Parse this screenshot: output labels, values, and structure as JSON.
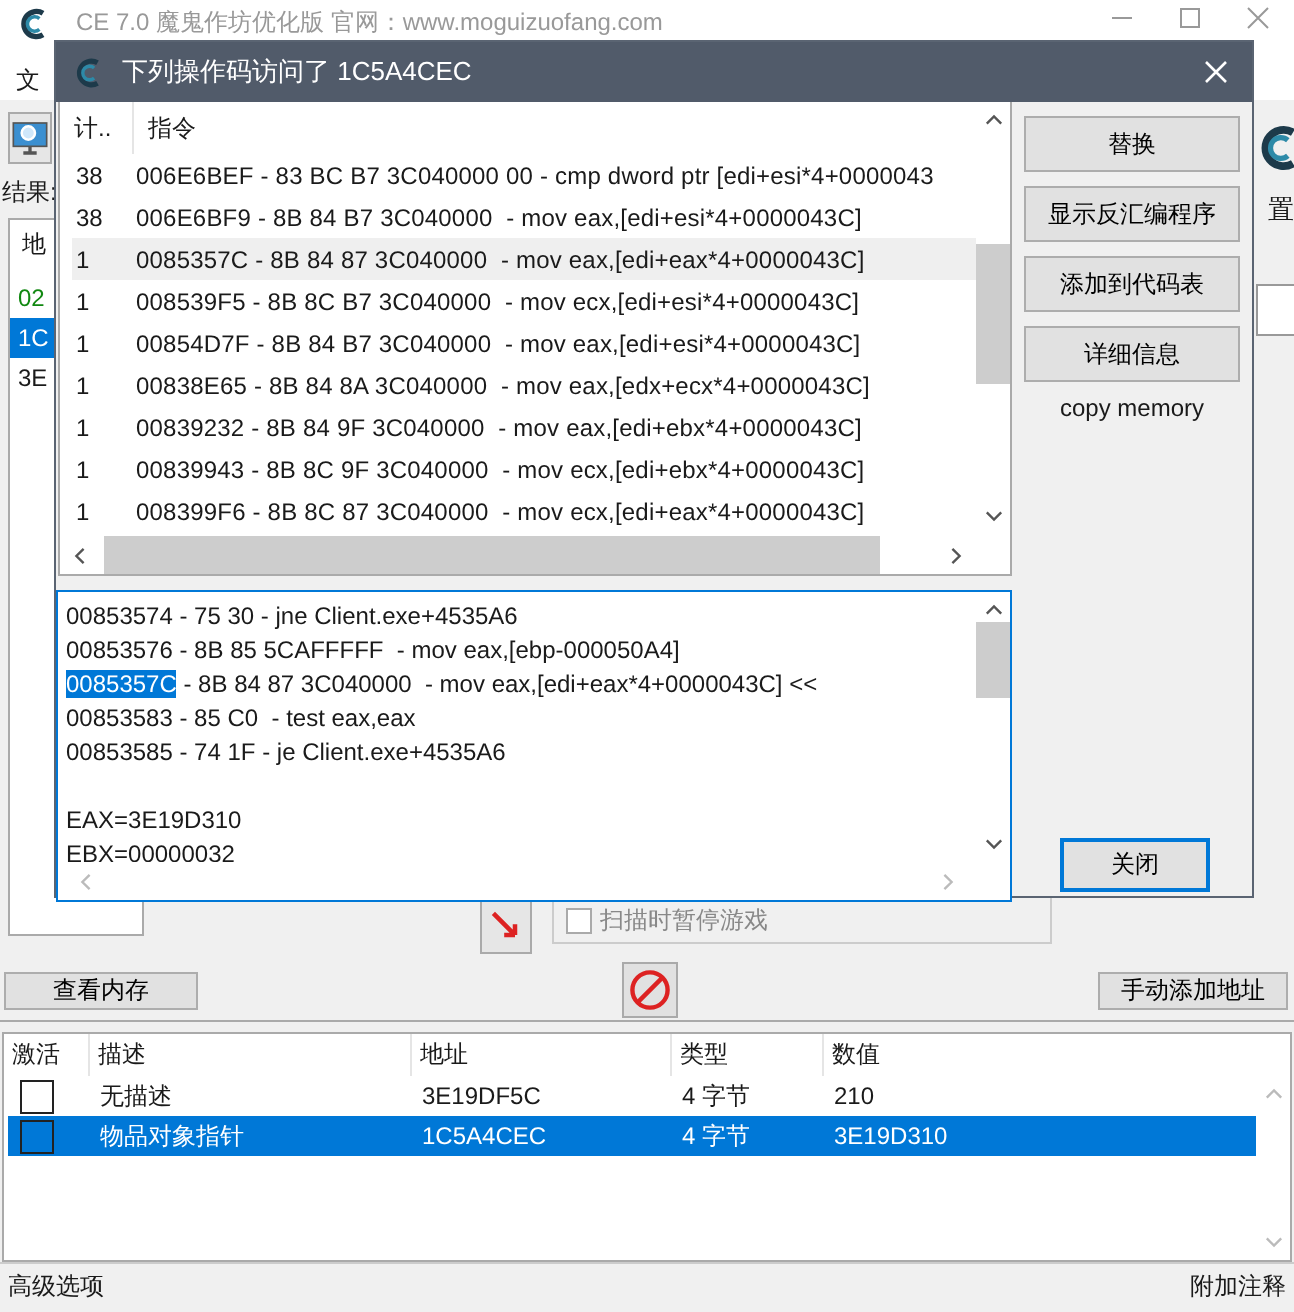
{
  "main_window": {
    "title": "CE 7.0 魔鬼作坊优化版 官网：www.moguizuofang.com",
    "menu": [
      "文"
    ],
    "results_label": "结果:",
    "address_header": "地",
    "result_items": [
      {
        "text": "02",
        "color": "#118811",
        "selected": false
      },
      {
        "text": "1C",
        "color": "#ffffff",
        "selected": true
      },
      {
        "text": "3E",
        "color": "#1a1a1a",
        "selected": false
      }
    ],
    "settings_label": "置",
    "pause_checkbox": {
      "label": "扫描时暂停游戏",
      "checked": false
    },
    "view_memory_button": "查看内存",
    "add_address_button": "手动添加地址",
    "table": {
      "columns": [
        "激活",
        "描述",
        "地址",
        "类型",
        "数值"
      ],
      "rows": [
        {
          "active": false,
          "description": "无描述",
          "address": "3E19DF5C",
          "type": "4 字节",
          "value": "210",
          "selected": false
        },
        {
          "active": false,
          "description": "物品对象指针",
          "address": "1C5A4CEC",
          "type": "4 字节",
          "value": "3E19D310",
          "selected": true
        }
      ]
    },
    "status_bar": {
      "left": "高级选项",
      "right": "附加注释"
    }
  },
  "dialog": {
    "title": "下列操作码访问了 1C5A4CEC",
    "columns": [
      "计..",
      "指令"
    ],
    "rows": [
      {
        "count": "38",
        "instruction": "006E6BEF - 83 BC B7 3C040000 00 - cmp dword ptr [edi+esi*4+0000043",
        "selected": false
      },
      {
        "count": "38",
        "instruction": "006E6BF9 - 8B 84 B7 3C040000  - mov eax,[edi+esi*4+0000043C]",
        "selected": false
      },
      {
        "count": "1",
        "instruction": "0085357C - 8B 84 87 3C040000  - mov eax,[edi+eax*4+0000043C]",
        "selected": true
      },
      {
        "count": "1",
        "instruction": "008539F5 - 8B 8C B7 3C040000  - mov ecx,[edi+esi*4+0000043C]",
        "selected": false
      },
      {
        "count": "1",
        "instruction": "00854D7F - 8B 84 B7 3C040000  - mov eax,[edi+esi*4+0000043C]",
        "selected": false
      },
      {
        "count": "1",
        "instruction": "00838E65 - 8B 84 8A 3C040000  - mov eax,[edx+ecx*4+0000043C]",
        "selected": false
      },
      {
        "count": "1",
        "instruction": "00839232 - 8B 84 9F 3C040000  - mov eax,[edi+ebx*4+0000043C]",
        "selected": false
      },
      {
        "count": "1",
        "instruction": "00839943 - 8B 8C 9F 3C040000  - mov ecx,[edi+ebx*4+0000043C]",
        "selected": false
      },
      {
        "count": "1",
        "instruction": "008399F6 - 8B 8C 87 3C040000  - mov ecx,[edi+eax*4+0000043C]",
        "selected": false
      }
    ],
    "buttons": [
      "替换",
      "显示反汇编程序",
      "添加到代码表",
      "详细信息"
    ],
    "copy_memory_label": "copy memory",
    "disassembly": [
      {
        "address": "00853574",
        "rest": " - 75 30 - jne Client.exe+4535A6",
        "selected": false
      },
      {
        "address": "00853576",
        "rest": " - 8B 85 5CAFFFFF  - mov eax,[ebp-000050A4]",
        "selected": false
      },
      {
        "address": "0085357C",
        "rest": " - 8B 84 87 3C040000  - mov eax,[edi+eax*4+0000043C] <<",
        "selected": true
      },
      {
        "address": "00853583",
        "rest": " - 85 C0  - test eax,eax",
        "selected": false
      },
      {
        "address": "00853585",
        "rest": " - 74 1F - je Client.exe+4535A6",
        "selected": false
      }
    ],
    "registers": [
      "EAX=3E19D310",
      "EBX=00000032"
    ],
    "close_button": "关闭"
  }
}
